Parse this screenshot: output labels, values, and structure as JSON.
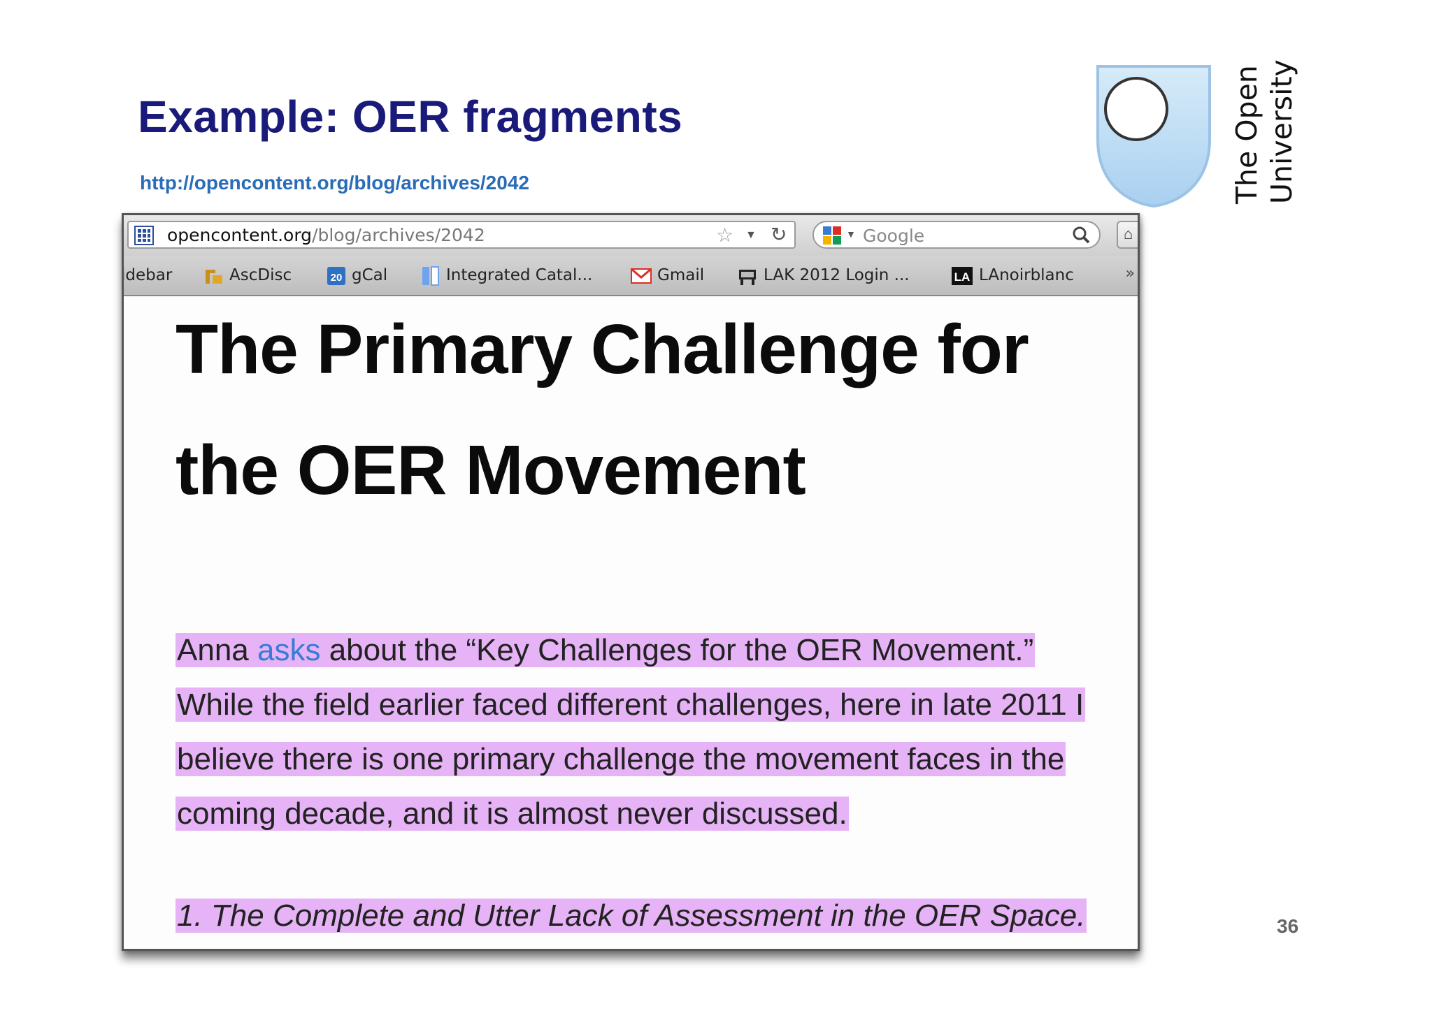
{
  "slide": {
    "title": "Example: OER fragments",
    "url": "http://opencontent.org/blog/archives/2042",
    "page_number": "36",
    "logo": {
      "line1": "The Open",
      "line2": "University",
      "icon": "open-university-shield-icon"
    }
  },
  "browser": {
    "address": {
      "domain": "opencontent.org",
      "path": "/blog/archives/2042"
    },
    "search": {
      "placeholder": "Google"
    },
    "bookmarks": [
      {
        "label": "idebar",
        "icon": "none"
      },
      {
        "label": "AscDisc",
        "icon": "fm-icon"
      },
      {
        "label": "gCal",
        "icon": "calendar-icon",
        "badge": "20"
      },
      {
        "label": "Integrated Catal...",
        "icon": "catalog-icon"
      },
      {
        "label": "Gmail",
        "icon": "gmail-icon"
      },
      {
        "label": "LAK 2012 Login ...",
        "icon": "lak-icon"
      },
      {
        "label": "LAnoirblanc",
        "icon": "la-icon",
        "badge": "LA"
      }
    ],
    "overflow": "»"
  },
  "article": {
    "title_line1": "The Primary Challenge for",
    "title_line2": "the OER Movement",
    "line1_prefix": "Anna ",
    "line1_link": "asks",
    "line1_suffix": " about the “Key Challenges for the OER Movement.”",
    "line2": "While the field earlier faced different challenges, here in late 2011 I",
    "line3": "believe there is one primary challenge the movement faces in the",
    "line4": "coming decade, and it is almost never discussed.",
    "item1": "1. The Complete and Utter Lack of Assessment in the OER Space."
  },
  "colors": {
    "title": "#1a1a7a",
    "url": "#2a6cb8",
    "highlight": "#e6b4f6",
    "link": "#3a7bd5"
  }
}
